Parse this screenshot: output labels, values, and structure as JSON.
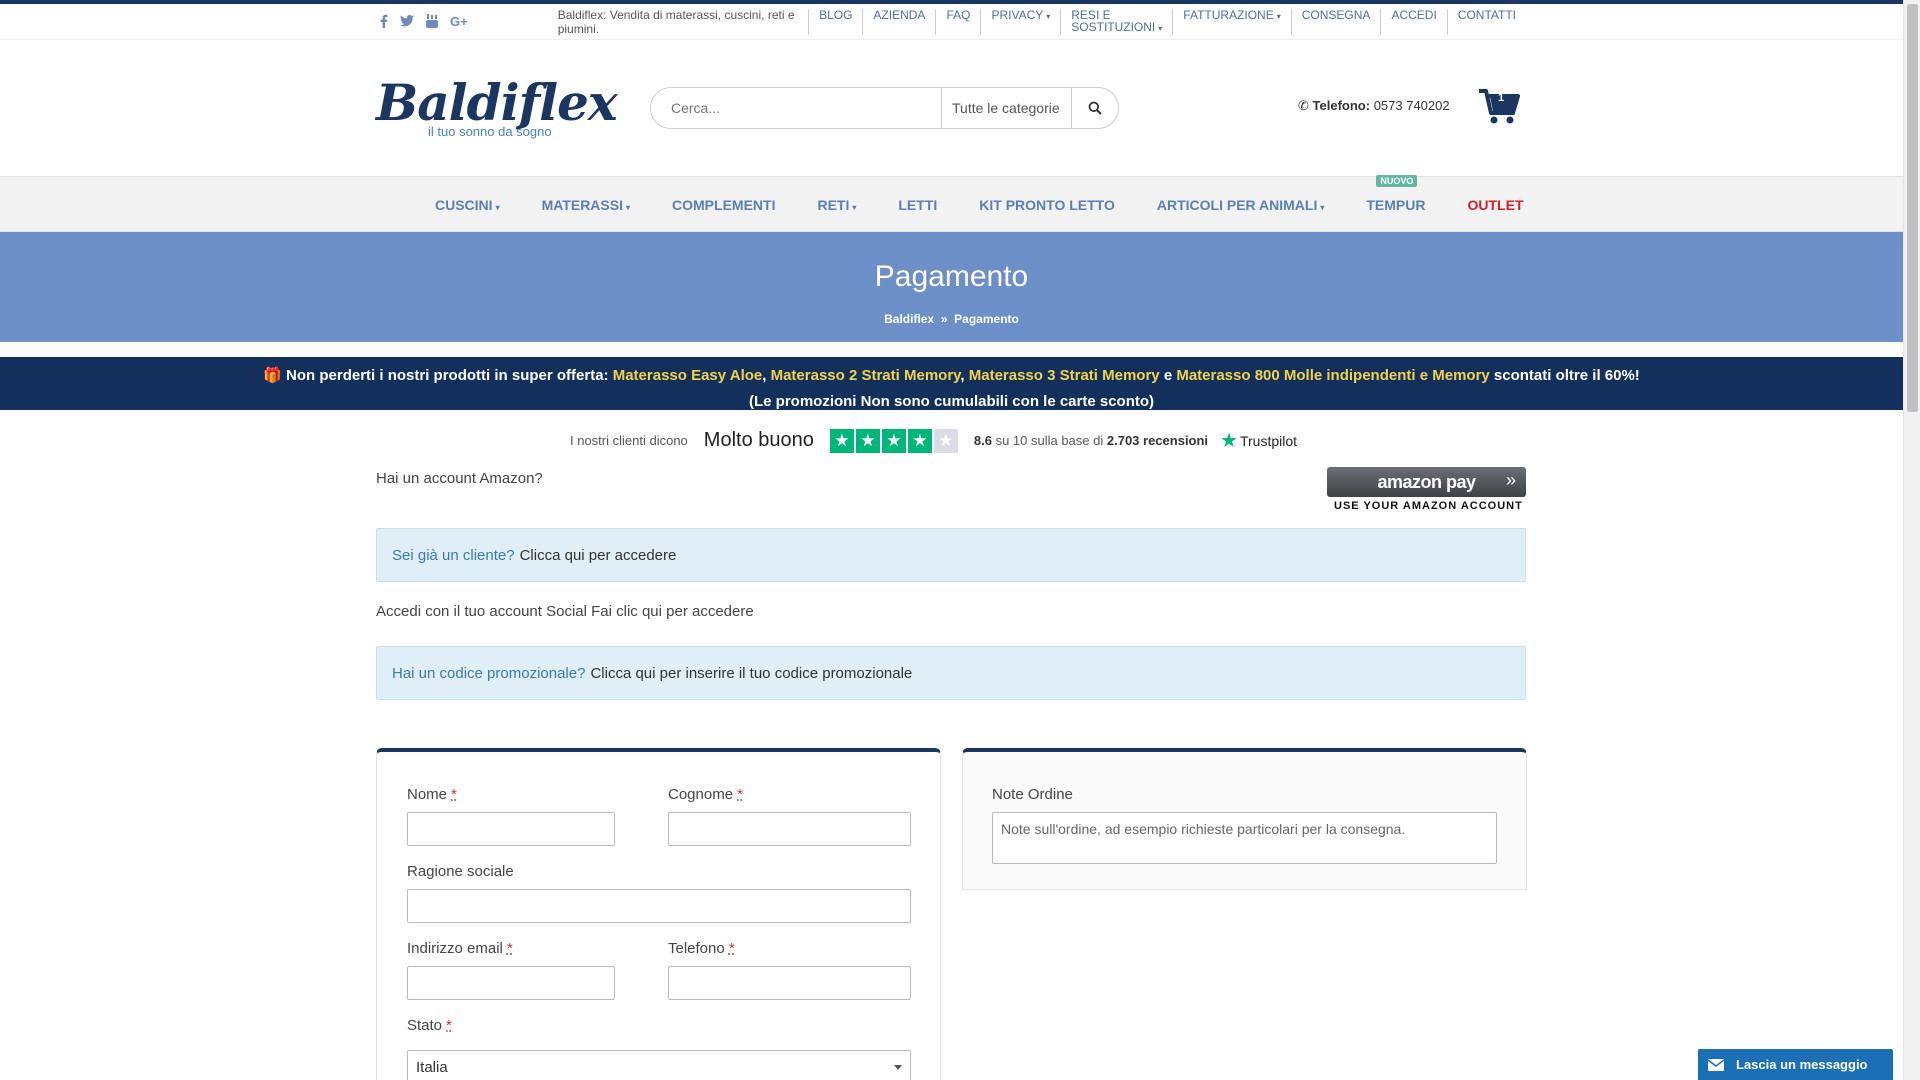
{
  "topbar": {
    "social_icons": [
      "facebook-icon",
      "twitter-icon",
      "youtube-icon",
      "google-plus-icon"
    ],
    "tagline": "Baldiflex: Vendita di materassi, cuscini, reti e piumini.",
    "links": [
      {
        "label": "BLOG",
        "dropdown": false
      },
      {
        "label": "AZIENDA",
        "dropdown": false
      },
      {
        "label": "FAQ",
        "dropdown": false
      },
      {
        "label": "PRIVACY",
        "dropdown": true
      },
      {
        "label": "RESI E SOSTITUZIONI",
        "dropdown": true
      },
      {
        "label": "FATTURAZIONE",
        "dropdown": true
      },
      {
        "label": "CONSEGNA",
        "dropdown": false
      },
      {
        "label": "ACCEDI",
        "dropdown": false
      },
      {
        "label": "CONTATTI",
        "dropdown": false
      }
    ]
  },
  "header": {
    "logo_text": "Baldiflex",
    "logo_subtitle": "il tuo sonno    da sogno",
    "search_placeholder": "Cerca...",
    "search_category": "Tutte le categorie",
    "phone_label": "Telefono:",
    "phone_number": "0573 740202",
    "cart_count": "1"
  },
  "nav": {
    "items": [
      {
        "label": "CUSCINI",
        "dropdown": true
      },
      {
        "label": "MATERASSI",
        "dropdown": true
      },
      {
        "label": "COMPLEMENTI",
        "dropdown": false
      },
      {
        "label": "RETI",
        "dropdown": true
      },
      {
        "label": "LETTI",
        "dropdown": false
      },
      {
        "label": "KIT PRONTO LETTO",
        "dropdown": false
      },
      {
        "label": "ARTICOLI PER ANIMALI",
        "dropdown": true
      },
      {
        "label": "TEMPUR",
        "dropdown": false,
        "badge": "NUOVO"
      },
      {
        "label": "OUTLET",
        "dropdown": false
      }
    ]
  },
  "titleband": {
    "title": "Pagamento",
    "breadcrumb_home": "Baldiflex",
    "breadcrumb_sep": "»",
    "breadcrumb_current": "Pagamento"
  },
  "promo": {
    "intro": "Non perderti i nostri prodotti in super offerta:",
    "p1": "Materasso Easy Aloe",
    "p2": "Materasso 2 Strati Memory",
    "p3": "Materasso 3 Strati Memory",
    "conj": "e",
    "p4": "Materasso 800 Molle indipendenti e Memory",
    "outro": "scontati oltre il 60%!",
    "note": "(Le promozioni Non sono cumulabili con le carte sconto)"
  },
  "trustpilot": {
    "intro": "I nostri clienti dicono",
    "rating_text": "Molto buono",
    "stars_filled": 4,
    "stars_total": 5,
    "score": "8.6",
    "score_mid": "su 10 sulla base di",
    "reviews": "2.703 recensioni",
    "brand": "Trustpilot"
  },
  "amazon": {
    "question": "Hai un account Amazon?",
    "button_label": "amazon pay",
    "caption": "USE YOUR AMAZON ACCOUNT"
  },
  "login_notice": {
    "question": "Sei già un cliente?",
    "action": "Clicca qui per accedere"
  },
  "social_login": "Accedi con il tuo account Social Fai clic qui per accedere",
  "coupon_notice": {
    "question": "Hai un codice promozionale?",
    "action": "Clicca qui per inserire il tuo codice promozionale"
  },
  "billing": {
    "first_name_label": "Nome",
    "last_name_label": "Cognome",
    "company_label": "Ragione sociale",
    "email_label": "Indirizzo email",
    "phone_label": "Telefono",
    "country_label": "Stato",
    "country_value": "Italia",
    "required_mark": "*"
  },
  "order_notes": {
    "label": "Note Ordine",
    "placeholder": "Note sull'ordine, ad esempio richieste particolari per la consegna."
  },
  "chat": {
    "label": "Lascia un messaggio"
  },
  "colors": {
    "brand_navy": "#1b3660",
    "accent_blue": "#6b8fc6",
    "promo_highlight": "#f2d34a",
    "trustpilot_green": "#00b67a",
    "outlet_red": "#d0202a"
  }
}
